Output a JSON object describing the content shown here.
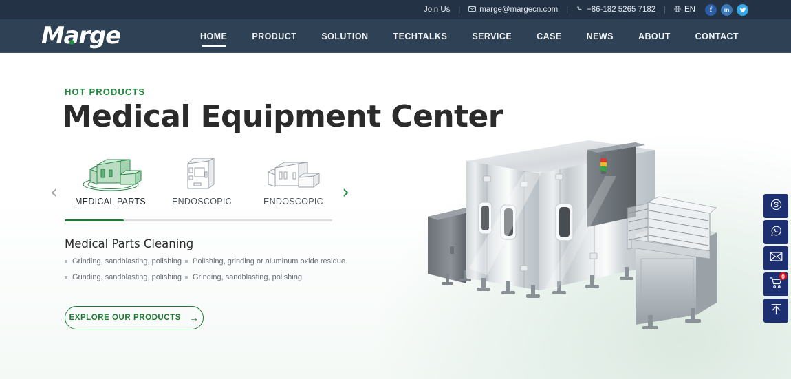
{
  "topbar": {
    "join_us": "Join Us",
    "email": "marge@margecn.com",
    "phone": "+86-182 5265 7182",
    "language": "EN",
    "email_icon": "envelope-icon",
    "phone_icon": "phone-icon",
    "globe_icon": "globe-icon",
    "socials": [
      {
        "name": "facebook-icon",
        "glyph": "f"
      },
      {
        "name": "linkedin-icon",
        "glyph": "in"
      },
      {
        "name": "twitter-icon",
        "glyph": "✔"
      }
    ]
  },
  "brand": {
    "name": "Marge"
  },
  "nav": {
    "items": [
      {
        "label": "HOME",
        "active": true
      },
      {
        "label": "PRODUCT",
        "active": false
      },
      {
        "label": "SOLUTION",
        "active": false
      },
      {
        "label": "TECHTALKS",
        "active": false
      },
      {
        "label": "SERVICE",
        "active": false
      },
      {
        "label": "CASE",
        "active": false
      },
      {
        "label": "NEWS",
        "active": false
      },
      {
        "label": "ABOUT",
        "active": false
      },
      {
        "label": "CONTACT",
        "active": false
      }
    ]
  },
  "hero": {
    "eyebrow": "HOT PRODUCTS",
    "title": "Medical Equipment Center",
    "accent_color": "#1f8a3c",
    "image_alt": "industrial-cleaning-machine"
  },
  "carousel": {
    "prev_label": "‹",
    "next_label": "›",
    "progress_percent": 22,
    "slides": [
      {
        "label": "MEDICAL PARTS",
        "active": true
      },
      {
        "label": "ENDOSCOPIC",
        "active": false
      },
      {
        "label": "ENDOSCOPIC",
        "active": false
      }
    ]
  },
  "product": {
    "title": "Medical Parts Cleaning",
    "features": [
      "Grinding, sandblasting, polishing",
      "Polishing, grinding or aluminum oxide residue",
      "Grinding, sandblasting, polishing",
      "Grinding, sandblasting, polishing"
    ],
    "cta_label": "EXPLORE OUR PRODUCTS",
    "cta_arrow": "→"
  },
  "rail": {
    "buttons": [
      {
        "name": "skype-button",
        "icon": "skype-icon"
      },
      {
        "name": "whatsapp-button",
        "icon": "whatsapp-icon"
      },
      {
        "name": "email-button",
        "icon": "envelope-icon"
      },
      {
        "name": "cart-button",
        "icon": "cart-icon",
        "badge": "0"
      },
      {
        "name": "back-to-top-button",
        "icon": "arrow-up-icon"
      }
    ]
  },
  "colors": {
    "topbar_bg": "#233345",
    "nav_bg": "#2e4155",
    "green": "#1f7a35",
    "rail_navy": "#1c2f71",
    "badge_red": "#e0121a"
  }
}
